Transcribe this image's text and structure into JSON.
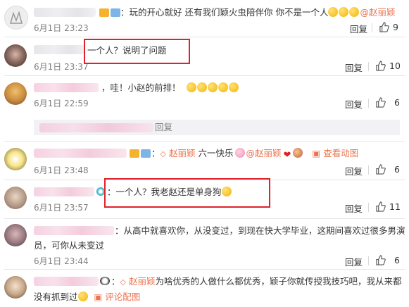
{
  "comments": [
    {
      "text": "：玩的开心就好 还有我们颖火虫陪伴你 你不是一个人",
      "mention": "@赵丽颖",
      "time": "6月1日 23:23",
      "reply": "回复",
      "likes": "9"
    },
    {
      "text": "一个人？说明了问题",
      "time": "6月1日 23:37",
      "reply": "回复",
      "likes": "10"
    },
    {
      "text": "，哇！小赵的前排！",
      "time": "6月1日 22:59",
      "reply": "回复",
      "likes": "6"
    },
    {
      "text_prefix": "赵丽颖",
      "text": "六一快乐",
      "mention": "@赵丽颖",
      "view_image": "查看动图",
      "time": "6月1日 23:48",
      "reply": "回复",
      "likes": "6"
    },
    {
      "text": "：一个人？我老赵还是单身狗",
      "time": "6月1日 23:57",
      "reply": "回复",
      "likes": "11"
    },
    {
      "text_line1": "：从高中就喜欢你，从没变过，到现在快大学毕业，这期间喜欢过很多男演",
      "text_line2": "员，可你从未变过",
      "time": "6月1日 23:44",
      "reply": "回复",
      "likes": "6"
    },
    {
      "text_prefix": "赵丽颖",
      "text_line1": "为啥优秀的人做什么都优秀，颖子你就传授我技巧吧，我从来都",
      "text_line2": "没有抓到过",
      "view_image": "评论配图"
    }
  ],
  "expand": {
    "text": "回复"
  },
  "colors": {
    "accent": "#eb7350",
    "highlight": "#e0232b"
  }
}
